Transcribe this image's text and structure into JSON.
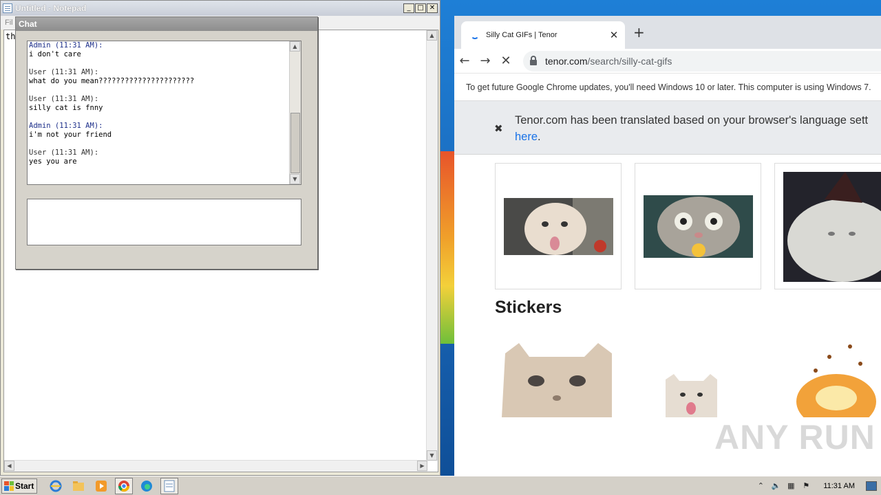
{
  "notepad": {
    "title": "Untitled - Notepad",
    "menu_fragment": "Fil",
    "content": "th",
    "buttons": {
      "minimize": "_",
      "maximize": "□",
      "close": "✕"
    }
  },
  "chat": {
    "title": "Chat",
    "messages": [
      {
        "header": "Admin (11:31 AM):",
        "body": "i don't care",
        "role": "admin"
      },
      {
        "header": "User (11:31 AM):",
        "body": "what do you mean??????????????????????",
        "role": "user"
      },
      {
        "header": "User (11:31 AM):",
        "body": "silly cat is fnny",
        "role": "user"
      },
      {
        "header": "Admin (11:31 AM):",
        "body": "i'm not your friend",
        "role": "admin"
      },
      {
        "header": "User (11:31 AM):",
        "body": "yes you are",
        "role": "user"
      }
    ],
    "input_value": ""
  },
  "browser": {
    "tab_title": "Silly Cat GIFs | Tenor",
    "tab_close": "✕",
    "new_tab": "+",
    "url_host": "tenor.com",
    "url_path": "/search/silly-cat-gifs",
    "infobar_text": "To get future Google Chrome updates, you'll need Windows 10 or later. This computer is using Windows 7.",
    "translate_text": "Tenor.com has been translated based on your browser's language sett",
    "translate_link": "here",
    "translate_suffix": ".",
    "translate_close": "✖",
    "stickers_heading": "Stickers",
    "watermark": "ANY RUN"
  },
  "taskbar": {
    "start_label": "Start",
    "clock": "11:31 AM",
    "icons": [
      "ie-icon",
      "explorer-icon",
      "media-player-icon",
      "chrome-icon",
      "edge-icon",
      "notepad-icon"
    ]
  },
  "colors": {
    "accent": "#1a73e8",
    "desktop": "#1a6fc4",
    "taskbar": "#d4d0c8"
  }
}
